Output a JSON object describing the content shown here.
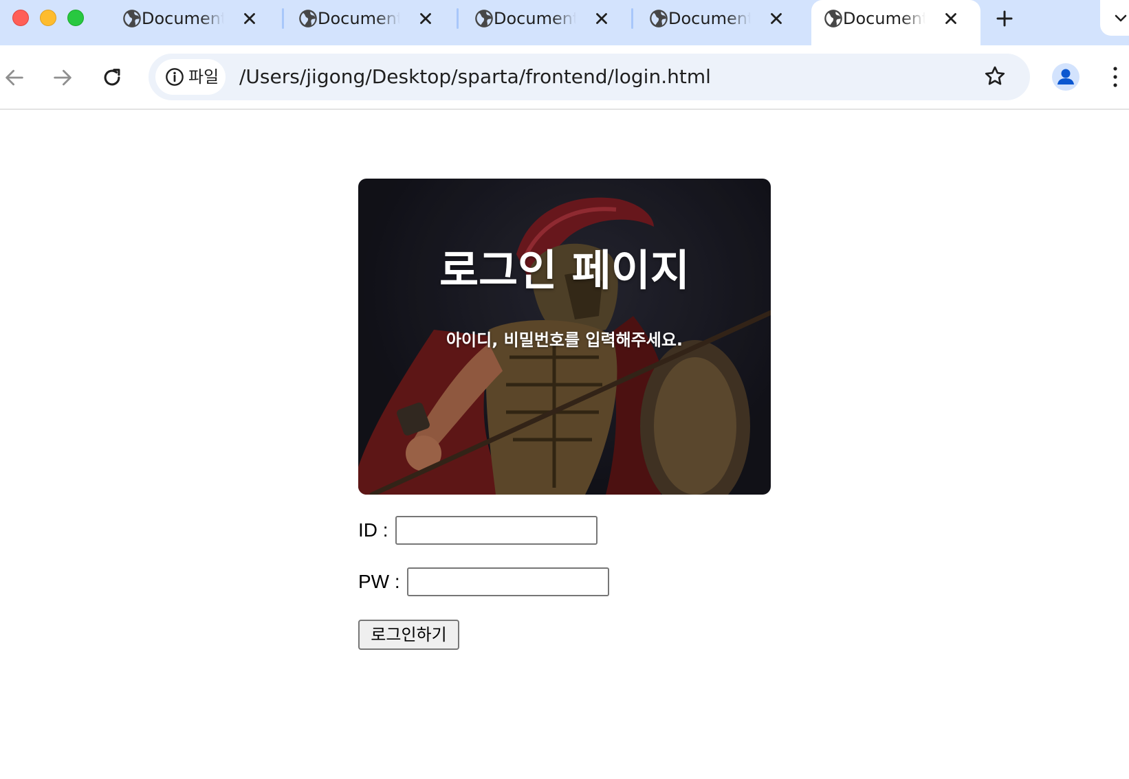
{
  "browser": {
    "tabs": [
      {
        "title": "Document",
        "active": false
      },
      {
        "title": "Document",
        "active": false
      },
      {
        "title": "Document",
        "active": false
      },
      {
        "title": "Document",
        "active": false
      },
      {
        "title": "Document",
        "active": true
      }
    ],
    "site_chip_label": "파일",
    "url": "/Users/jigong/Desktop/sparta/frontend/login.html"
  },
  "page": {
    "hero": {
      "title": "로그인 페이지",
      "subtitle": "아이디, 비밀번호를 입력해주세요.",
      "image": "spartan-warrior-photo"
    },
    "form": {
      "id_label": "ID :",
      "id_value": "",
      "pw_label": "PW :",
      "pw_value": "",
      "submit_label": "로그인하기"
    }
  },
  "colors": {
    "tabstrip": "#d3e3fd",
    "omnibox": "#edf2fa",
    "accent": "#0b57d0"
  }
}
